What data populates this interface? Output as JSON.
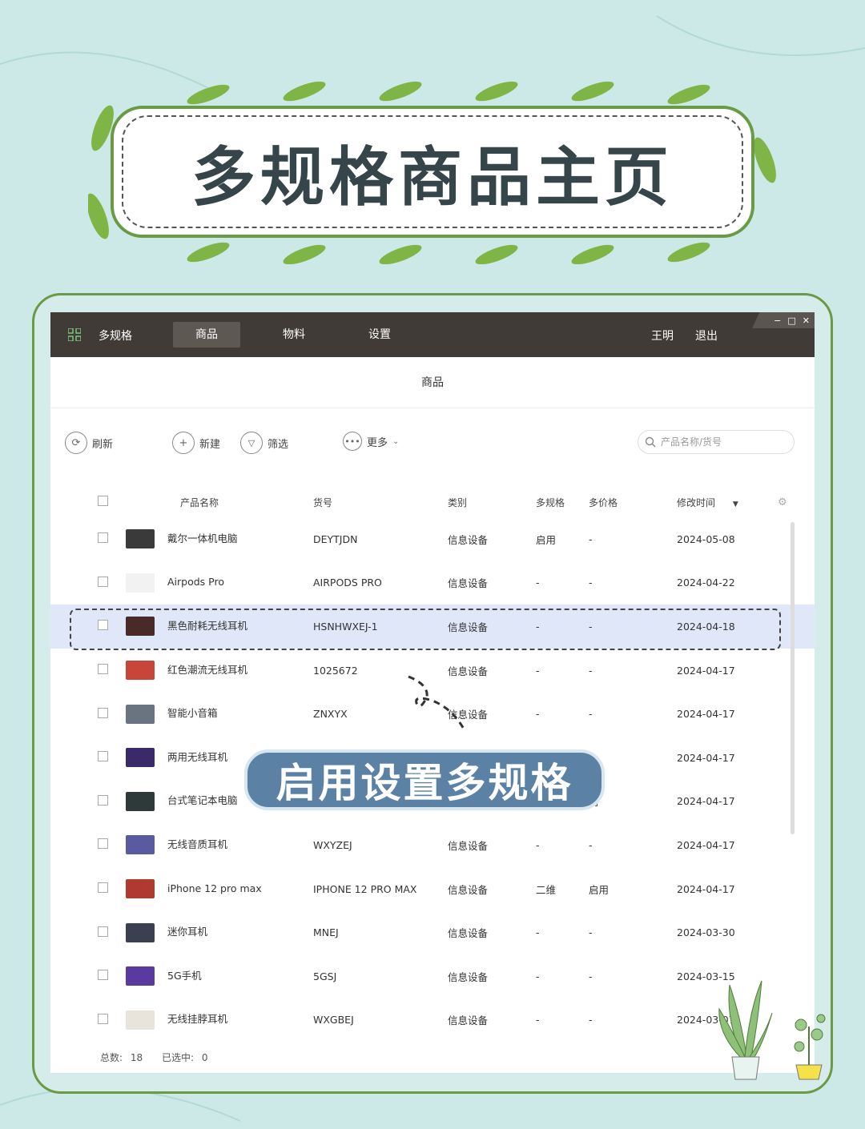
{
  "banner": {
    "title": "多规格商品主页"
  },
  "topbar": {
    "app_name": "多规格",
    "nav": [
      "商品",
      "物料",
      "设置"
    ],
    "active_nav": "商品",
    "user": "王明",
    "logout": "退出",
    "window_controls": [
      "−",
      "□",
      "✕"
    ]
  },
  "subheader": {
    "title": "商品"
  },
  "toolbar": {
    "refresh": "刷新",
    "new": "新建",
    "filter": "筛选",
    "more": "更多",
    "search_placeholder": "产品名称/货号"
  },
  "table": {
    "columns": [
      "产品名称",
      "货号",
      "类别",
      "多规格",
      "多价格",
      "修改时间"
    ],
    "sort_indicator": "▼",
    "rows": [
      {
        "name": "戴尔一体机电脑",
        "sku": "DEYTJDN",
        "category": "信息设备",
        "multi_spec": "启用",
        "multi_price": "-",
        "modified": "2024-05-08",
        "thumb_color": "#3a3a3a",
        "selected": false
      },
      {
        "name": "Airpods Pro",
        "sku": "AIRPODS PRO",
        "category": "信息设备",
        "multi_spec": "-",
        "multi_price": "-",
        "modified": "2024-04-22",
        "thumb_color": "#f2f2f2",
        "selected": false
      },
      {
        "name": "黑色耐耗无线耳机",
        "sku": "HSNHWXEJ-1",
        "category": "信息设备",
        "multi_spec": "-",
        "multi_price": "-",
        "modified": "2024-04-18",
        "thumb_color": "#4a2a28",
        "selected": true
      },
      {
        "name": "红色潮流无线耳机",
        "sku": "1025672",
        "category": "信息设备",
        "multi_spec": "-",
        "multi_price": "-",
        "modified": "2024-04-17",
        "thumb_color": "#c8453a",
        "selected": false
      },
      {
        "name": "智能小音箱",
        "sku": "ZNXYX",
        "category": "信息设备",
        "multi_spec": "-",
        "multi_price": "-",
        "modified": "2024-04-17",
        "thumb_color": "#6a7380",
        "selected": false
      },
      {
        "name": "两用无线耳机",
        "sku": "",
        "category": "",
        "multi_spec": "",
        "multi_price": "",
        "modified": "2024-04-17",
        "thumb_color": "#3b2a6a",
        "selected": false
      },
      {
        "name": "台式笔记本电脑",
        "sku": "",
        "category": "",
        "multi_spec": "",
        "multi_price": "用",
        "modified": "2024-04-17",
        "thumb_color": "#2e3a3a",
        "selected": false
      },
      {
        "name": "无线音质耳机",
        "sku": "WXYZEJ",
        "category": "信息设备",
        "multi_spec": "-",
        "multi_price": "-",
        "modified": "2024-04-17",
        "thumb_color": "#5a5aa0",
        "selected": false
      },
      {
        "name": "iPhone 12 pro max",
        "sku": "IPHONE 12 PRO MAX",
        "category": "信息设备",
        "multi_spec": "二维",
        "multi_price": "启用",
        "modified": "2024-04-17",
        "thumb_color": "#b03a30",
        "selected": false
      },
      {
        "name": "迷你耳机",
        "sku": "MNEJ",
        "category": "信息设备",
        "multi_spec": "-",
        "multi_price": "-",
        "modified": "2024-03-30",
        "thumb_color": "#3a4050",
        "selected": false
      },
      {
        "name": "5G手机",
        "sku": "5GSJ",
        "category": "信息设备",
        "multi_spec": "-",
        "multi_price": "-",
        "modified": "2024-03-15",
        "thumb_color": "#5a3aa0",
        "selected": false
      },
      {
        "name": "无线挂脖耳机",
        "sku": "WXGBEJ",
        "category": "信息设备",
        "multi_spec": "-",
        "multi_price": "-",
        "modified": "2024-03-07",
        "thumb_color": "#e8e4dc",
        "selected": false
      }
    ]
  },
  "footer": {
    "total_label": "总数:",
    "total": "18",
    "selected_label": "已选中:",
    "selected": "0"
  },
  "overlay": {
    "label": "启用设置多规格"
  },
  "colors": {
    "topbar": "#403b37",
    "selected_row": "#dfe7f8",
    "frame": "#6a9a45",
    "overlay": "#5b82a5"
  }
}
